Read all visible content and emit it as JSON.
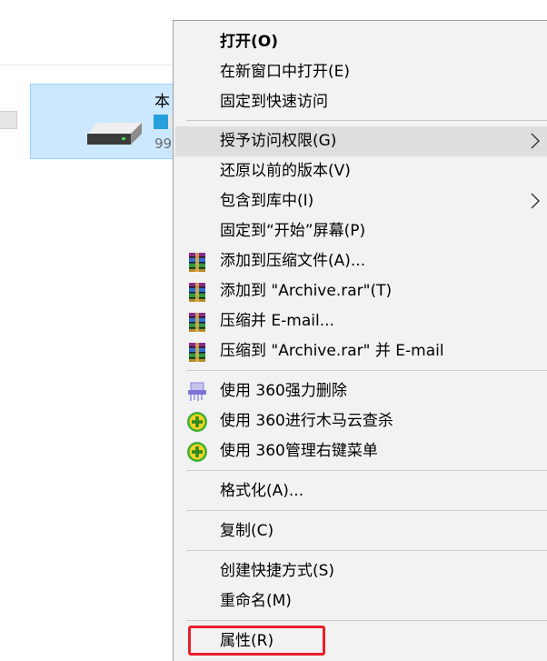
{
  "drive": {
    "name": "本",
    "free_text": "99",
    "usage_fraction": 0.45
  },
  "menu": {
    "items": [
      {
        "label": "打开(O)"
      },
      {
        "label": "在新窗口中打开(E)"
      },
      {
        "label": "固定到快速访问"
      },
      {
        "label": "授予访问权限(G)"
      },
      {
        "label": "还原以前的版本(V)"
      },
      {
        "label": "包含到库中(I)"
      },
      {
        "label": "固定到“开始”屏幕(P)"
      },
      {
        "label": "添加到压缩文件(A)..."
      },
      {
        "label": "添加到 \"Archive.rar\"(T)"
      },
      {
        "label": "压缩并 E-mail..."
      },
      {
        "label": "压缩到 \"Archive.rar\" 并 E-mail"
      },
      {
        "label": "使用 360强力删除"
      },
      {
        "label": "使用 360进行木马云查杀"
      },
      {
        "label": "使用 360管理右键菜单"
      },
      {
        "label": "格式化(A)..."
      },
      {
        "label": "复制(C)"
      },
      {
        "label": "创建快捷方式(S)"
      },
      {
        "label": "重命名(M)"
      },
      {
        "label": "属性(R)"
      }
    ]
  },
  "colors": {
    "menu_bg": "#f2f2f2",
    "hover_bg": "#dedede",
    "selection_bg": "#cce8ff",
    "highlight_border": "#e8202a",
    "drive_bar": "#26a0da"
  }
}
